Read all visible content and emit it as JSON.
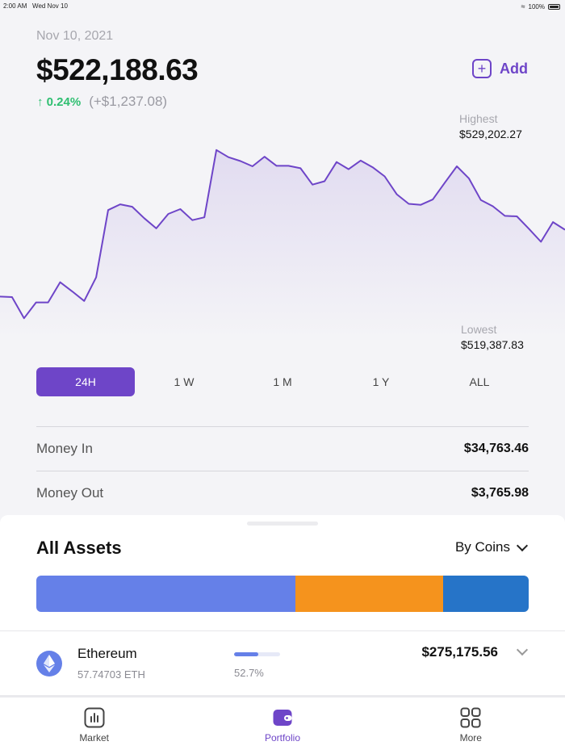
{
  "status_bar": {
    "time": "2:00 AM",
    "date": "Wed Nov 10",
    "battery": "100%"
  },
  "header": {
    "date": "Nov 10, 2021",
    "balance": "$522,188.63",
    "change_pct": "0.24%",
    "change_abs": "(+$1,237.08)",
    "add_label": "Add"
  },
  "chart": {
    "highest_label": "Highest",
    "highest_value": "$529,202.27",
    "lowest_label": "Lowest",
    "lowest_value": "$519,387.83",
    "line_color": "#6e45c8",
    "values": [
      520180,
      520170,
      519730,
      520060,
      520060,
      520480,
      520290,
      520090,
      520580,
      521980,
      522100,
      522050,
      521810,
      521600,
      521900,
      522000,
      521770,
      521830,
      523230,
      523080,
      523000,
      522890,
      523090,
      522900,
      522900,
      522850,
      522510,
      522580,
      522980,
      522830,
      523010,
      522870,
      522680,
      522310,
      522110,
      522090,
      522200,
      522550,
      522890,
      522640,
      522190,
      522060,
      521860,
      521850,
      521590,
      521320,
      521730,
      521570
    ],
    "range_min": 519387.83,
    "range_max": 529202.27
  },
  "ranges": [
    "24H",
    "1 W",
    "1 M",
    "1 Y",
    "ALL"
  ],
  "active_range": 0,
  "money": [
    {
      "label": "Money In",
      "value": "$34,763.46"
    },
    {
      "label": "Money Out",
      "value": "$3,765.98"
    }
  ],
  "assets": {
    "title": "All Assets",
    "filter_label": "By Coins",
    "allocation": [
      {
        "share": 52.7,
        "color": "#6580e8"
      },
      {
        "share": 30.0,
        "color": "#f5931d"
      },
      {
        "share": 17.3,
        "color": "#2674c8"
      }
    ],
    "items": [
      {
        "name": "Ethereum",
        "amount": "57.74703 ETH",
        "pct_label": "52.7%",
        "pct": 52.7,
        "value": "$275,175.56"
      }
    ]
  },
  "tabbar": {
    "tabs": [
      {
        "label": "Market",
        "icon": "bar-chart-icon"
      },
      {
        "label": "Portfolio",
        "icon": "wallet-icon"
      },
      {
        "label": "More",
        "icon": "grid-icon"
      }
    ],
    "active": 1
  }
}
